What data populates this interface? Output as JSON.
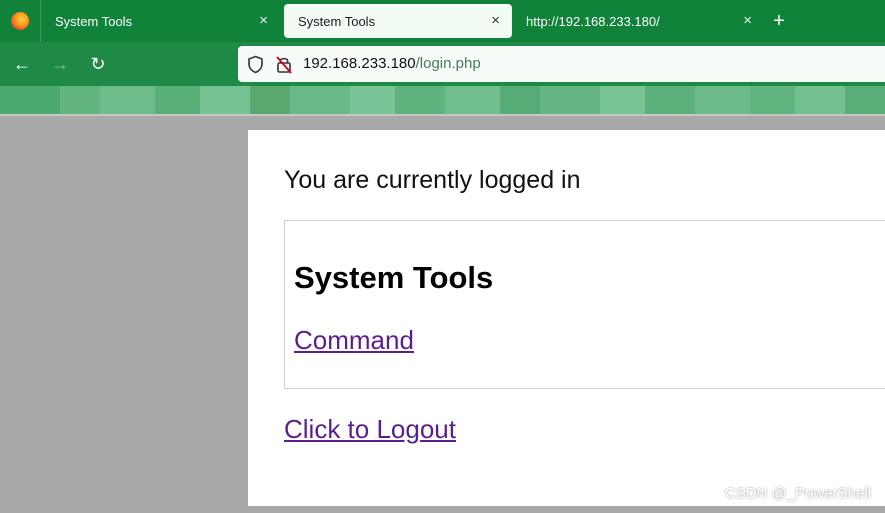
{
  "browser": {
    "tabs": [
      {
        "label": "System Tools",
        "close": "×",
        "active": false
      },
      {
        "label": "System Tools",
        "close": "×",
        "active": true
      },
      {
        "label": "http://192.168.233.180/",
        "close": "×",
        "active": false
      }
    ],
    "new_tab": "+",
    "nav": {
      "back": "←",
      "forward": "→",
      "reload": "↻"
    },
    "url": {
      "host": "192.168.233.180",
      "path": "/login.php"
    }
  },
  "page": {
    "status_text": "You are currently logged in",
    "tools_title": "System Tools",
    "command_link": "Command",
    "logout_link": "Click to Logout"
  },
  "watermark": "CSDN @_PowerShell",
  "colors": {
    "tabbar": "#10823a",
    "navbar": "#1e8a45",
    "link_visited": "#5a1f8e",
    "page_bg": "#ffffff",
    "backdrop": "#a9a9a9"
  },
  "icons": {
    "browser_logo": "firefox-logo",
    "shield": "tracking-shield-icon",
    "lock": "insecure-lock-icon"
  }
}
